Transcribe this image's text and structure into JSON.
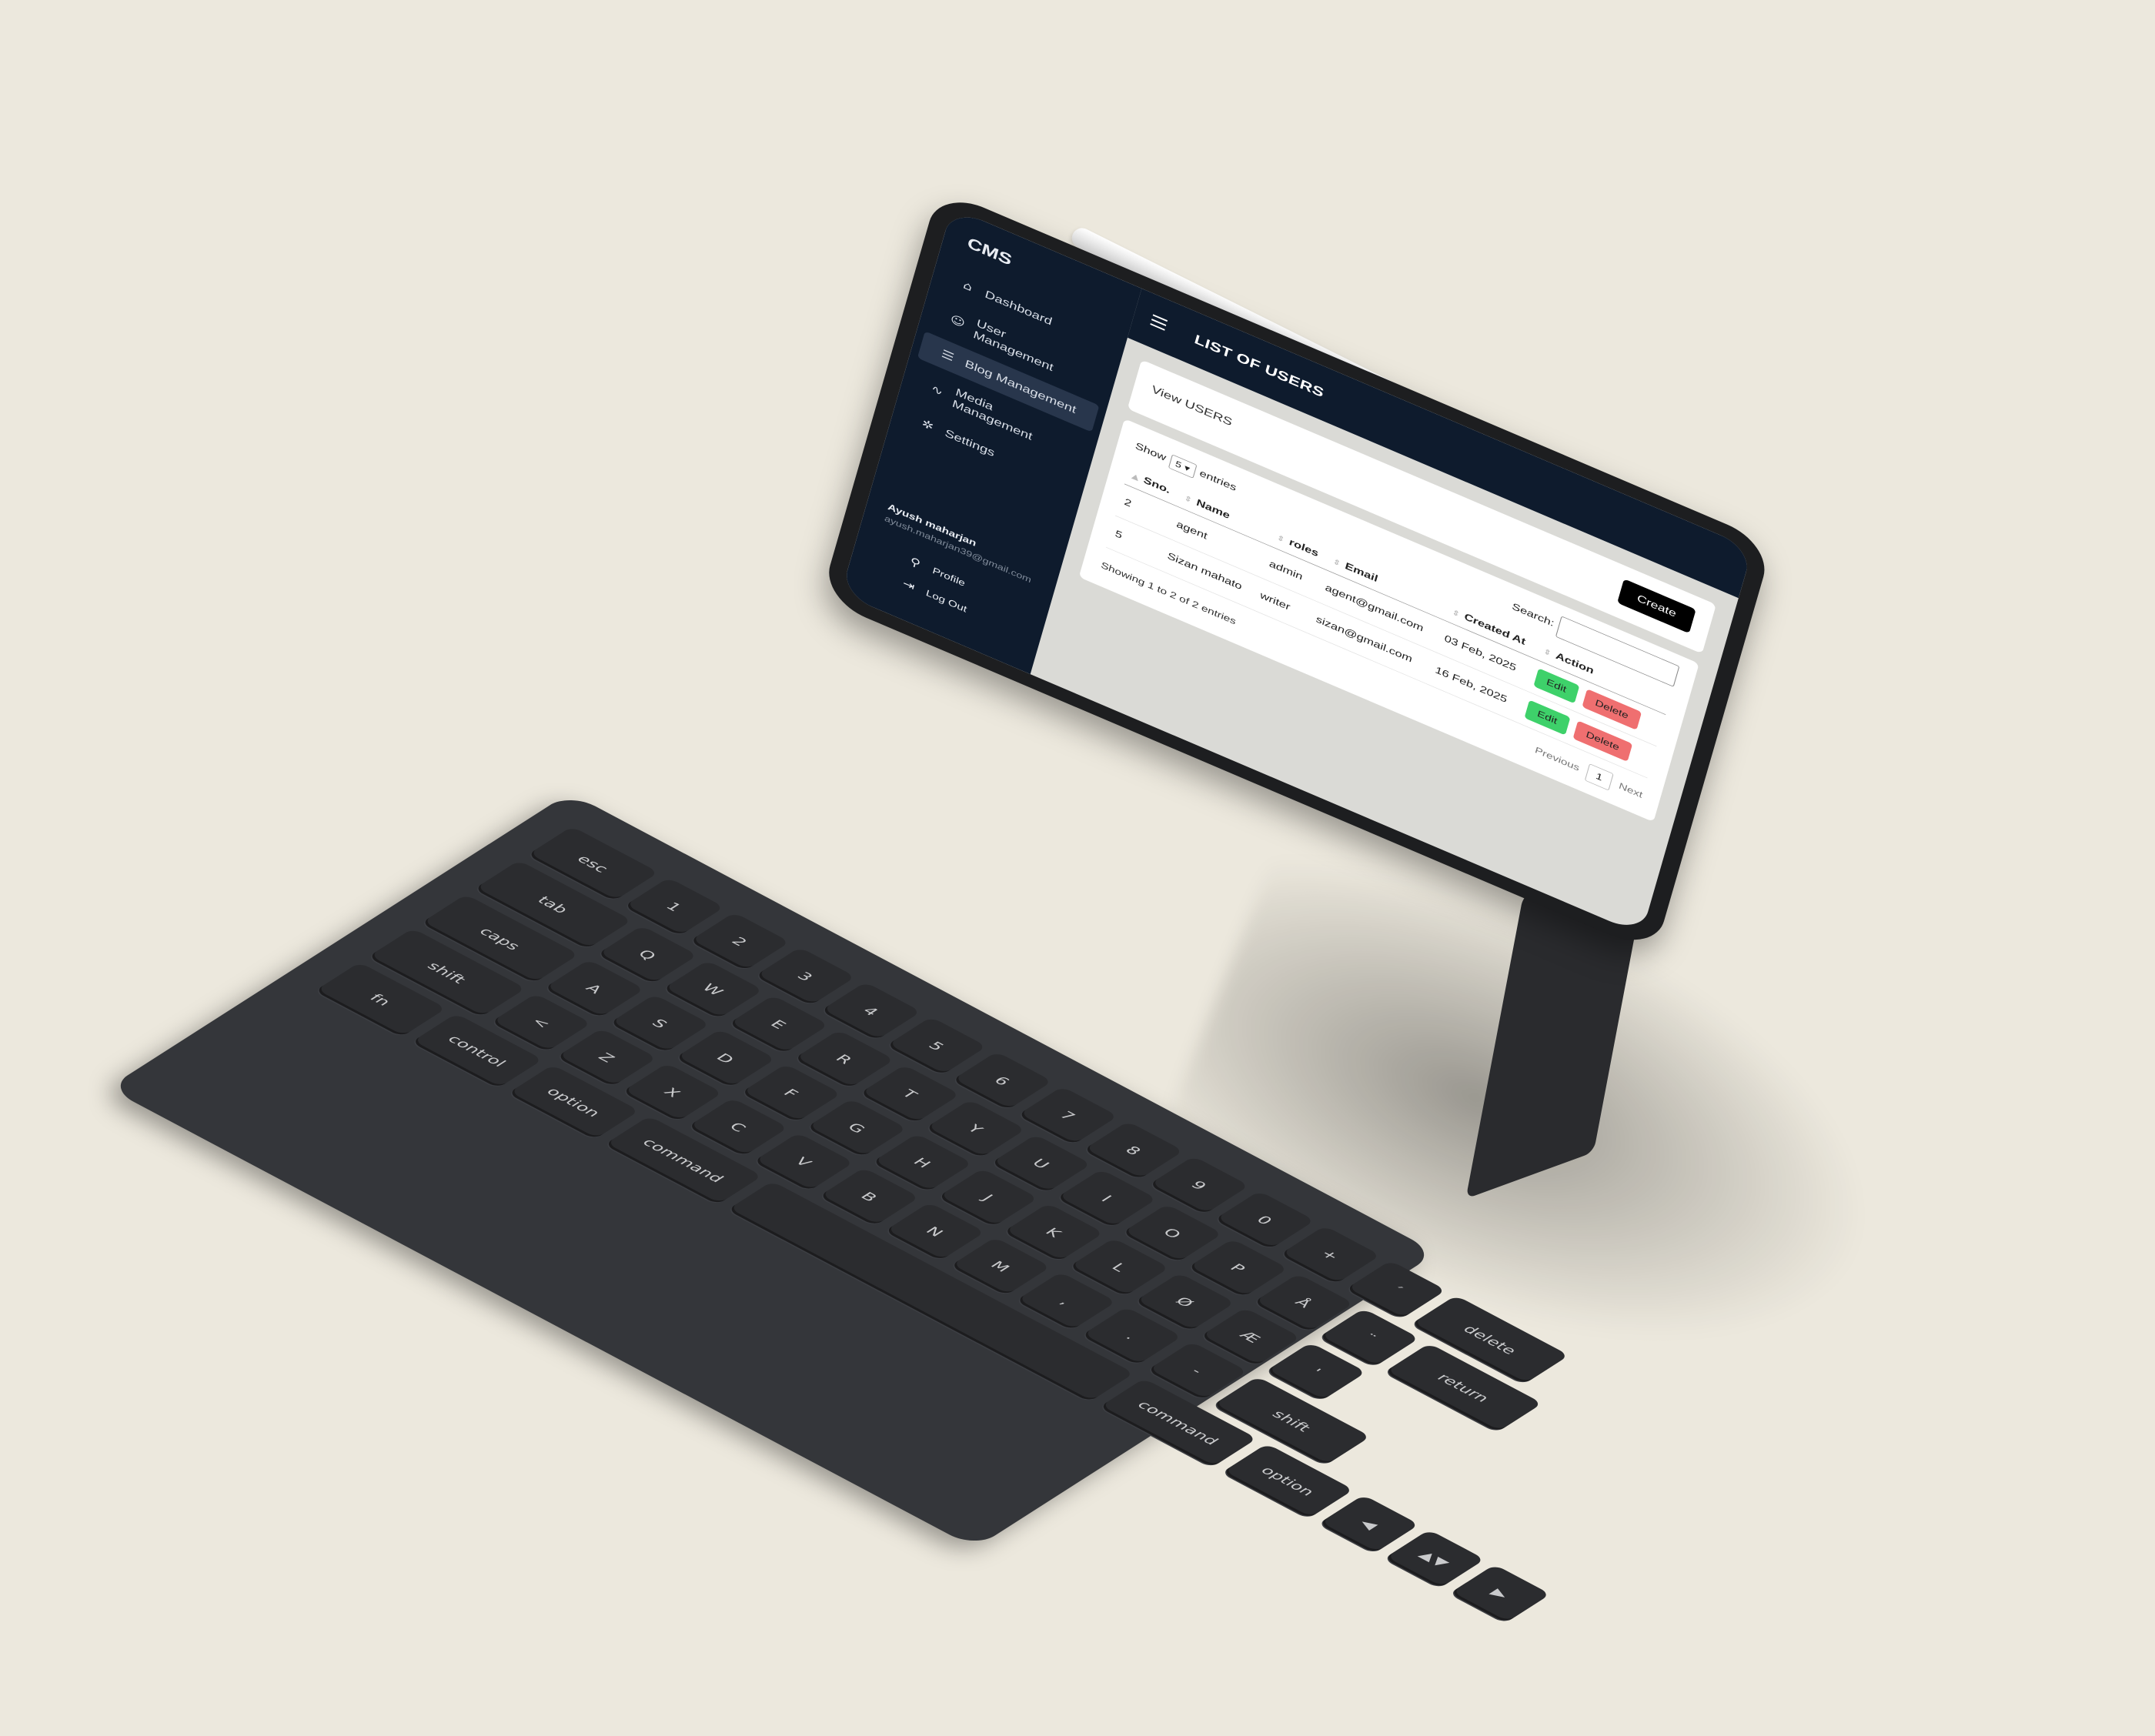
{
  "app": {
    "brand": "CMS"
  },
  "sidebar": {
    "items": [
      {
        "label": "Dashboard",
        "icon": "home-icon",
        "active": false
      },
      {
        "label": "User Management",
        "icon": "user-icon",
        "active": false
      },
      {
        "label": "Blog Management",
        "icon": "list-icon",
        "active": true
      },
      {
        "label": "Media Management",
        "icon": "activity-icon",
        "active": false
      },
      {
        "label": "Settings",
        "icon": "gear-icon",
        "active": false
      }
    ],
    "user": {
      "name": "Ayush maharjan",
      "email": "ayush.maharjan39@gmail.com",
      "profile_label": "Profile",
      "logout_label": "Log Out"
    }
  },
  "header": {
    "title": "LIST OF USERS"
  },
  "view_card": {
    "label": "View USERS",
    "create_label": "Create"
  },
  "table": {
    "show_label": "Show",
    "show_value": "5",
    "entries_label": "entries",
    "search_label": "Search:",
    "search_value": "",
    "columns": [
      "Sno.",
      "Name",
      "roles",
      "Email",
      "Created At",
      "Action"
    ],
    "rows": [
      {
        "sno": "2",
        "name": "agent",
        "role": "admin",
        "email": "agent@gmail.com",
        "created": "03 Feb, 2025"
      },
      {
        "sno": "5",
        "name": "Sizan mahato",
        "role": "writer",
        "email": "sizan@gmail.com",
        "created": "16 Feb, 2025"
      }
    ],
    "edit_label": "Edit",
    "delete_label": "Delete",
    "footer_info": "Showing 1 to 2 of 2 entries",
    "pagination": {
      "previous": "Previous",
      "current": "1",
      "next": "Next"
    }
  },
  "keyboard": {
    "rows": [
      [
        "esc",
        "1",
        "2",
        "3",
        "4",
        "5",
        "6",
        "7",
        "8",
        "9",
        "0",
        "+",
        "´",
        "delete"
      ],
      [
        "tab",
        "Q",
        "W",
        "E",
        "R",
        "T",
        "Y",
        "U",
        "I",
        "O",
        "P",
        "Å",
        "¨",
        "return"
      ],
      [
        "caps",
        "A",
        "S",
        "D",
        "F",
        "G",
        "H",
        "J",
        "K",
        "L",
        "Ø",
        "Æ",
        "'"
      ],
      [
        "shift",
        "<",
        "Z",
        "X",
        "C",
        "V",
        "B",
        "N",
        "M",
        ",",
        ".",
        "-",
        "shift"
      ],
      [
        "fn",
        "control",
        "option",
        "command",
        " ",
        "command",
        "option",
        "◀",
        "▲▼",
        "▶"
      ]
    ]
  },
  "colors": {
    "sidebar_bg": "#0e1b2d",
    "edit_btn": "#3ed16a",
    "delete_btn": "#ef6f70",
    "create_btn": "#000000",
    "page_bg": "#ece8dd"
  }
}
